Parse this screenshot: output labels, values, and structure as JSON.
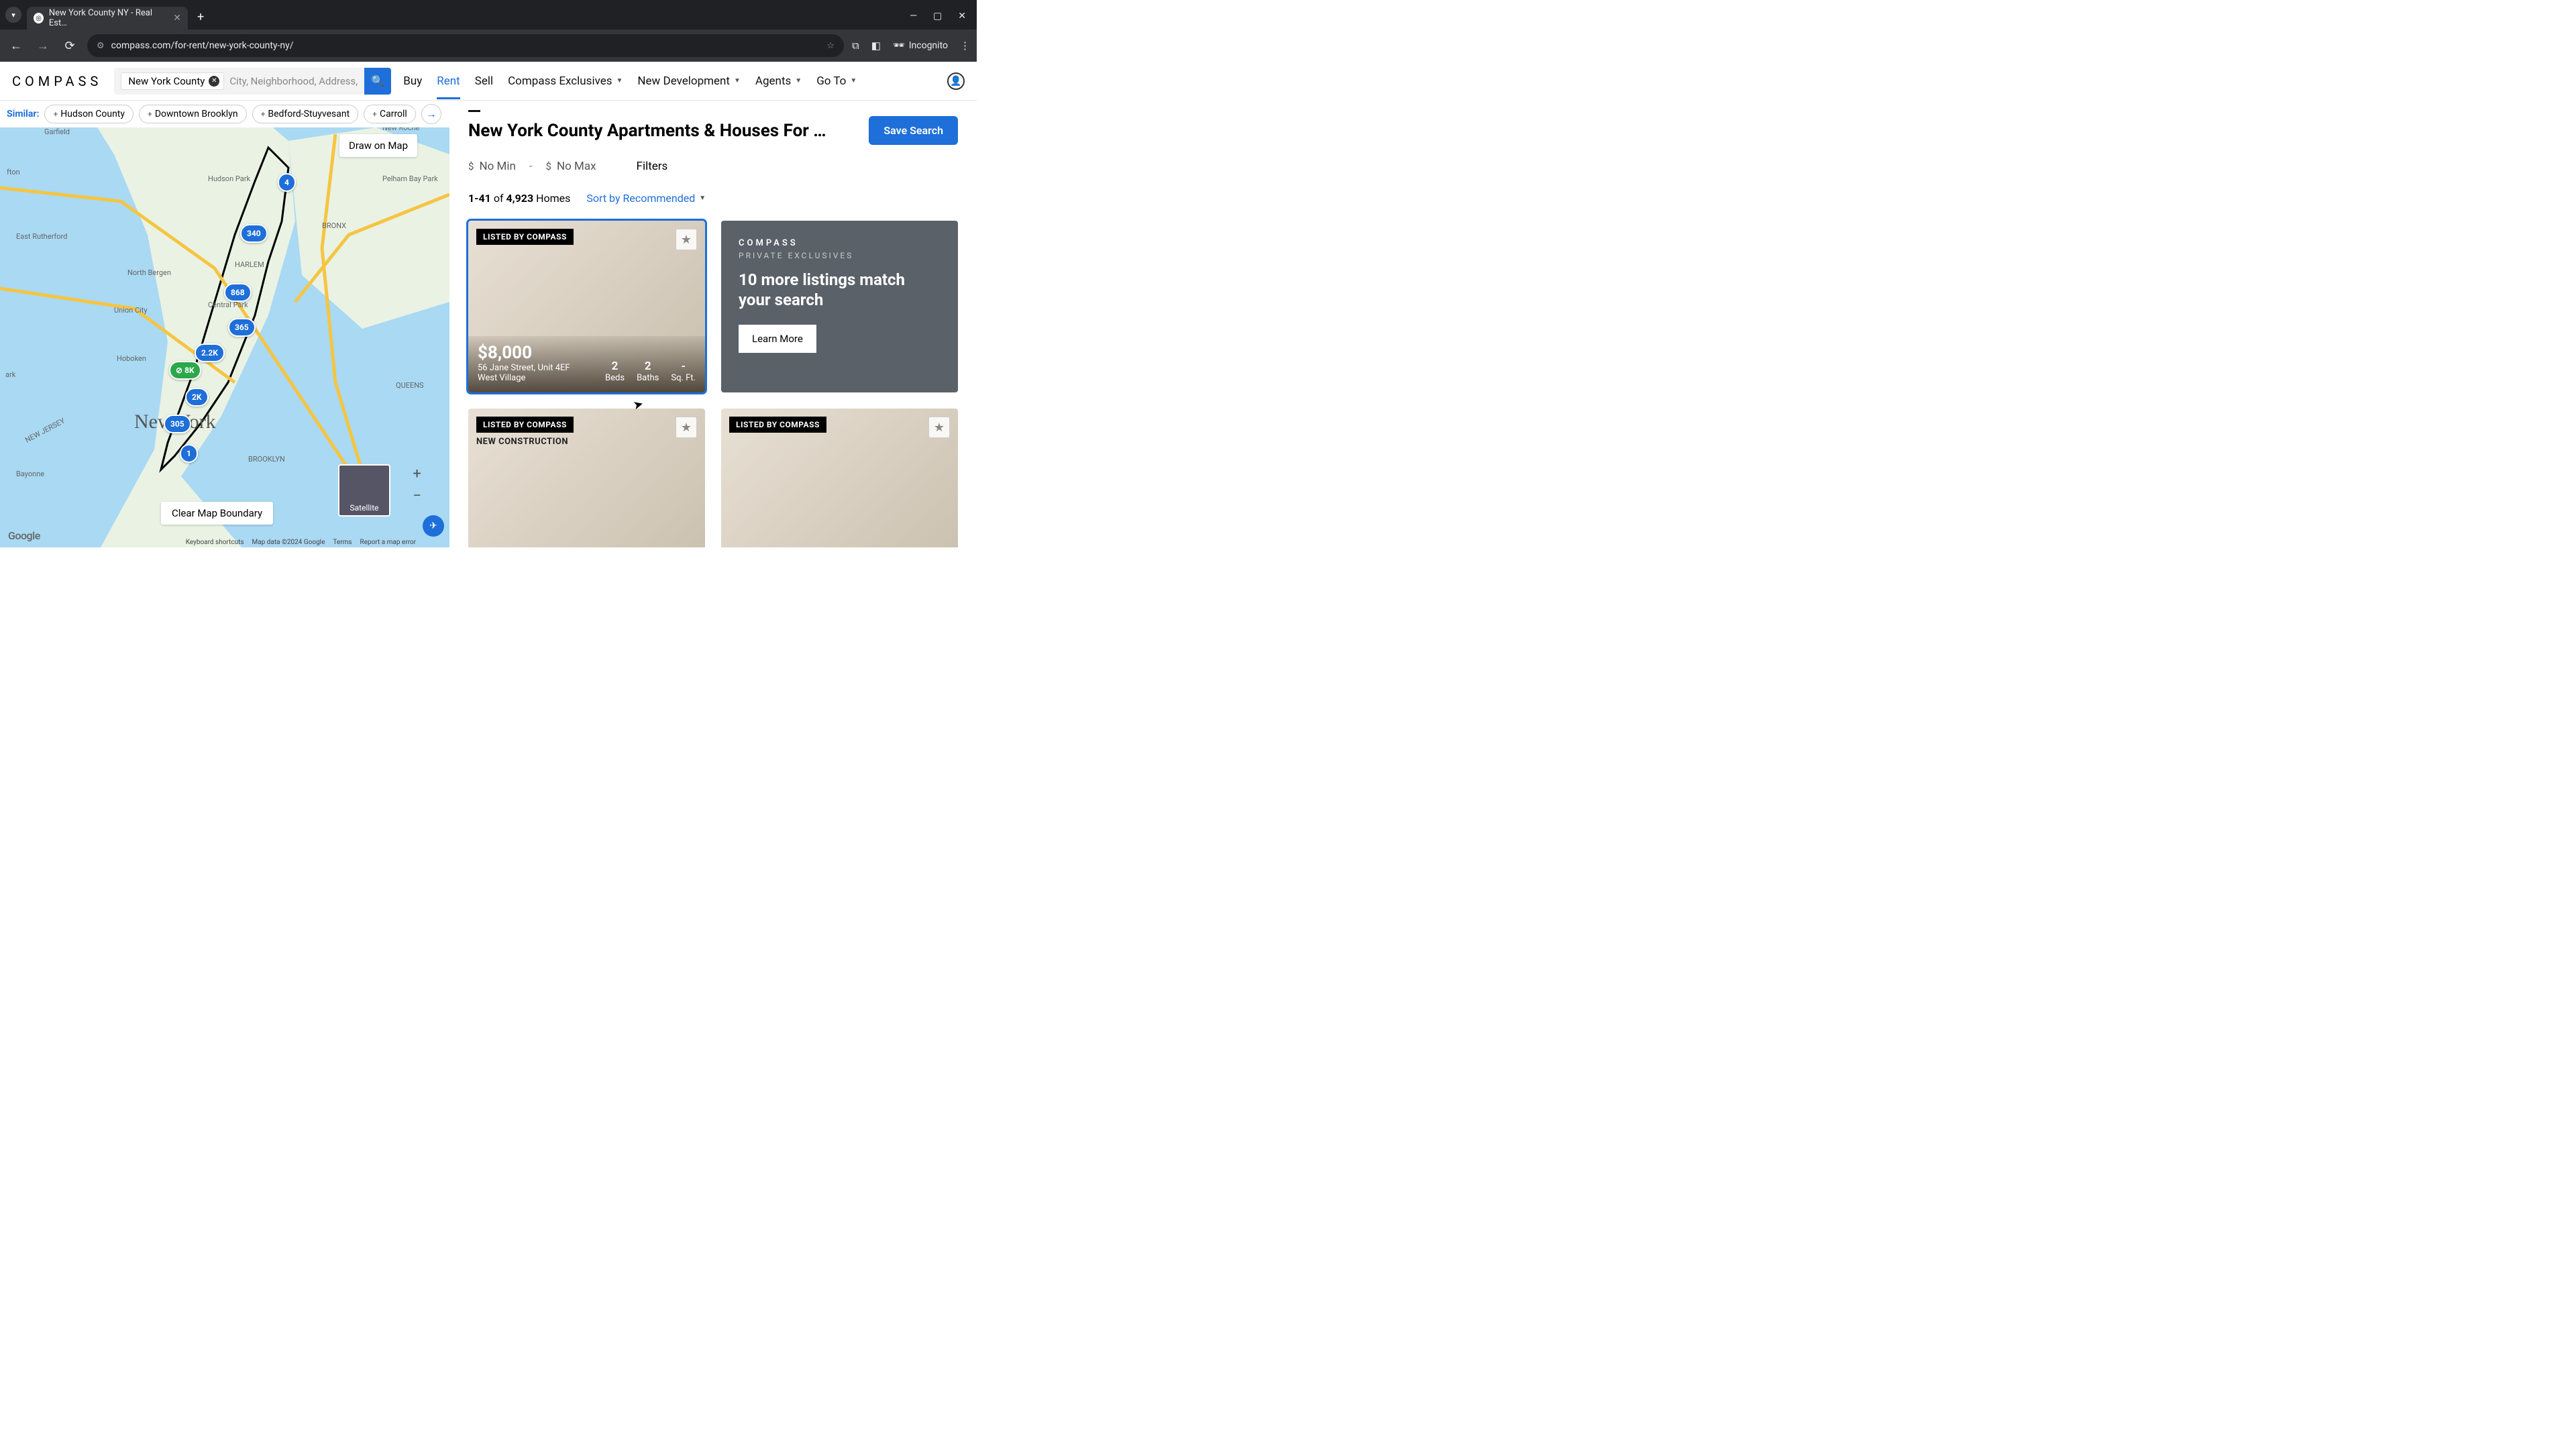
{
  "browser": {
    "tab_title": "New York County NY - Real Est…",
    "url": "compass.com/for-rent/new-york-county-ny/",
    "incognito_label": "Incognito"
  },
  "header": {
    "logo": "COMPASS",
    "search_tag": "New York County",
    "search_placeholder": "City, Neighborhood, Address,",
    "nav": {
      "buy": "Buy",
      "rent": "Rent",
      "sell": "Sell",
      "exclusives": "Compass Exclusives",
      "newdev": "New Development",
      "agents": "Agents",
      "goto": "Go To"
    }
  },
  "similar": {
    "label": "Similar:",
    "chips": [
      "Hudson County",
      "Downtown Brooklyn",
      "Bedford-Stuyvesant",
      "Carroll"
    ]
  },
  "map": {
    "draw_label": "Draw on Map",
    "clear_label": "Clear Map Boundary",
    "satellite_label": "Satellite",
    "city_label": "New York",
    "pins": [
      {
        "v": "4",
        "l": 414,
        "t": 108
      },
      {
        "v": "340",
        "l": 358,
        "t": 184
      },
      {
        "v": "868",
        "l": 334,
        "t": 272
      },
      {
        "v": "365",
        "l": 340,
        "t": 324
      },
      {
        "v": "2.2K",
        "l": 290,
        "t": 362
      },
      {
        "v": "8K",
        "l": 252,
        "t": 388,
        "green": true
      },
      {
        "v": "2K",
        "l": 276,
        "t": 428
      },
      {
        "v": "305",
        "l": 244,
        "t": 468
      },
      {
        "v": "1",
        "l": 268,
        "t": 512
      }
    ],
    "footer": {
      "ks": "Keyboard shortcuts",
      "md": "Map data ©2024 Google",
      "terms": "Terms",
      "report": "Report a map error"
    },
    "google": "Google"
  },
  "results": {
    "title": "New York County Apartments & Houses For …",
    "save": "Save Search",
    "no_min": "No Min",
    "no_max": "No Max",
    "filters": "Filters",
    "count_range": "1-41",
    "count_of": "of",
    "count_total": "4,923",
    "count_homes": "Homes",
    "sort_label": "Sort by Recommended"
  },
  "listings": [
    {
      "badge": "LISTED BY COMPASS",
      "price": "$8,000",
      "addr1": "56 Jane Street, Unit 4EF",
      "addr2": "West Village",
      "beds": "2",
      "baths": "2",
      "sqft": "-",
      "selected": true
    },
    {
      "promo": true,
      "logo": "COMPASS",
      "sub": "PRIVATE EXCLUSIVES",
      "headline": "10 more listings match your search",
      "cta": "Learn More"
    },
    {
      "badge": "LISTED BY COMPASS",
      "subbadge": "NEW CONSTRUCTION"
    },
    {
      "badge": "LISTED BY COMPASS"
    }
  ],
  "stat_labels": {
    "beds": "Beds",
    "baths": "Baths",
    "sqft": "Sq. Ft."
  }
}
